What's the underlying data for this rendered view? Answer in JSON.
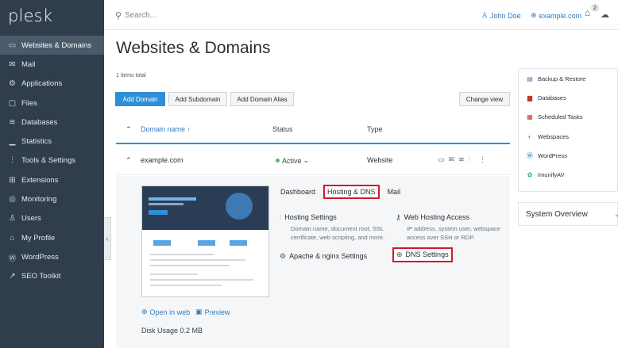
{
  "brand": {
    "logo_text": "plesk"
  },
  "sidebar": {
    "items": [
      {
        "icon": "monitor-icon",
        "glyph": "▭",
        "label": "Websites & Domains"
      },
      {
        "icon": "mail-icon",
        "glyph": "✉",
        "label": "Mail"
      },
      {
        "icon": "applications-icon",
        "glyph": "⚙",
        "label": "Applications"
      },
      {
        "icon": "files-icon",
        "glyph": "▢",
        "label": "Files"
      },
      {
        "icon": "databases-icon",
        "glyph": "≋",
        "label": "Databases"
      },
      {
        "icon": "statistics-icon",
        "glyph": "▁",
        "label": "Statistics"
      },
      {
        "icon": "tools-icon",
        "glyph": "⫶",
        "label": "Tools & Settings"
      },
      {
        "icon": "extensions-icon",
        "glyph": "⊞",
        "label": "Extensions"
      },
      {
        "icon": "monitoring-icon",
        "glyph": "◎",
        "label": "Monitoring"
      },
      {
        "icon": "users-icon",
        "glyph": "♙",
        "label": "Users"
      },
      {
        "icon": "profile-icon",
        "glyph": "⌂",
        "label": "My Profile"
      },
      {
        "icon": "wordpress-icon",
        "glyph": "Ⓦ",
        "label": "WordPress"
      },
      {
        "icon": "seo-toolkit-icon",
        "glyph": "↗",
        "label": "SEO Toolkit"
      }
    ]
  },
  "topbar": {
    "search_placeholder": "Search...",
    "user_name": "John Doe",
    "domain": "example.com",
    "notifications_count": "2"
  },
  "main": {
    "title": "Websites & Domains",
    "items_total": "1 items total",
    "buttons": {
      "add_domain": "Add Domain",
      "add_subdomain": "Add Subdomain",
      "add_domain_alias": "Add Domain Alias",
      "change_view": "Change view"
    },
    "table": {
      "col_domain": "Domain name ↑",
      "col_status": "Status",
      "col_type": "Type",
      "row": {
        "domain": "example.com",
        "status": "Active",
        "type": "Website"
      }
    },
    "detail": {
      "tabs": [
        "Dashboard",
        "Hosting & DNS",
        "Mail"
      ],
      "hosting_settings": {
        "title": "Hosting Settings",
        "desc_line1": "Domain name, document root, SSL",
        "desc_line2": "certificate, web scripting, and more."
      },
      "web_hosting_access": {
        "title": "Web Hosting Access",
        "desc_line1": "IP address, system user, webspace",
        "desc_line2": "access over SSH or RDP."
      },
      "apache_nginx": {
        "title": "Apache & nginx Settings"
      },
      "dns_settings": {
        "title": "DNS Settings"
      },
      "open_in_web": "Open in web",
      "preview": "Preview",
      "disk_usage": "Disk Usage 0.2 MB"
    }
  },
  "right_panel": {
    "items": [
      {
        "label": "Backup & Restore",
        "color": "#3b7bc0"
      },
      {
        "label": "Databases",
        "color": "#c0392b"
      },
      {
        "label": "Scheduled Tasks",
        "color": "#c0392b"
      },
      {
        "label": "Webspaces",
        "color": "#e67e22"
      },
      {
        "label": "WordPress",
        "color": "#21759b"
      },
      {
        "label": "ImunifyAV",
        "color": "#27ae60"
      }
    ],
    "system_overview": "System Overview"
  },
  "colors": {
    "sidebar_bg": "#2f3d4c",
    "accent": "#2f8fd6",
    "highlight_red": "#d01b2a",
    "status_green": "#5cb85c"
  }
}
